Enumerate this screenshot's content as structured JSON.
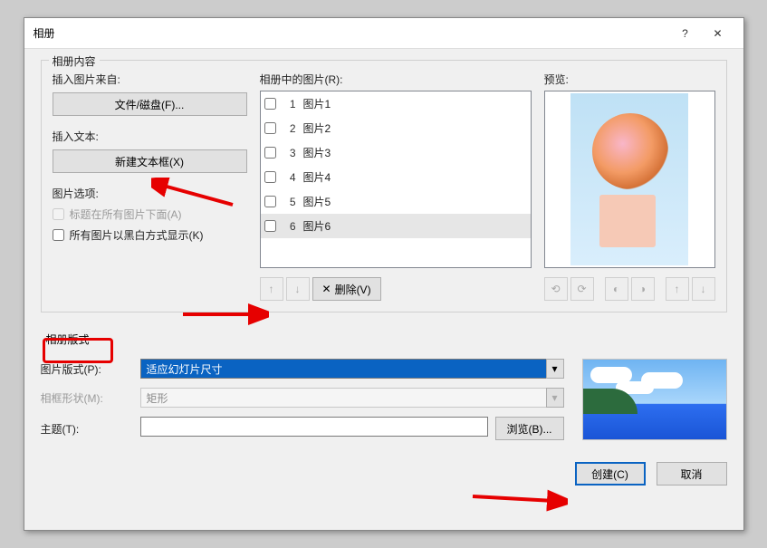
{
  "dialog": {
    "title": "相册"
  },
  "titlebar": {
    "help": "?",
    "close": "✕"
  },
  "content": {
    "legend": "相册内容",
    "insertFromLabel": "插入图片来自:",
    "fileDiskBtn": "文件/磁盘(F)...",
    "insertTextLabel": "插入文本:",
    "newTextboxBtn": "新建文本框(X)",
    "picOptionsLabel": "图片选项:",
    "captionBelow": "标题在所有图片下面(A)",
    "allBW": "所有图片以黑白方式显示(K)",
    "picturesInAlbumLabel": "相册中的图片(R):",
    "previewLabel": "预览:",
    "items": [
      {
        "n": "1",
        "name": "图片1",
        "sel": false
      },
      {
        "n": "2",
        "name": "图片2",
        "sel": false
      },
      {
        "n": "3",
        "name": "图片3",
        "sel": false
      },
      {
        "n": "4",
        "name": "图片4",
        "sel": false
      },
      {
        "n": "5",
        "name": "图片5",
        "sel": false
      },
      {
        "n": "6",
        "name": "图片6",
        "sel": true
      }
    ],
    "removeBtn": "删除(V)"
  },
  "layout": {
    "heading": "相册版式",
    "picLayoutLabel": "图片版式(P):",
    "picLayoutValue": "适应幻灯片尺寸",
    "frameShapeLabel": "相框形状(M):",
    "frameShapeValue": "矩形",
    "themeLabel": "主题(T):",
    "themeValue": "",
    "browseBtn": "浏览(B)..."
  },
  "footer": {
    "create": "创建(C)",
    "cancel": "取消"
  },
  "glyph": {
    "up": "↑",
    "down": "↓",
    "x": "✕",
    "tri": "▾",
    "rotl": "⟲",
    "rotr": "⟳",
    "contrast": "◐",
    "contrast2": "◑",
    "bright": "☀",
    "dim": "✦"
  }
}
